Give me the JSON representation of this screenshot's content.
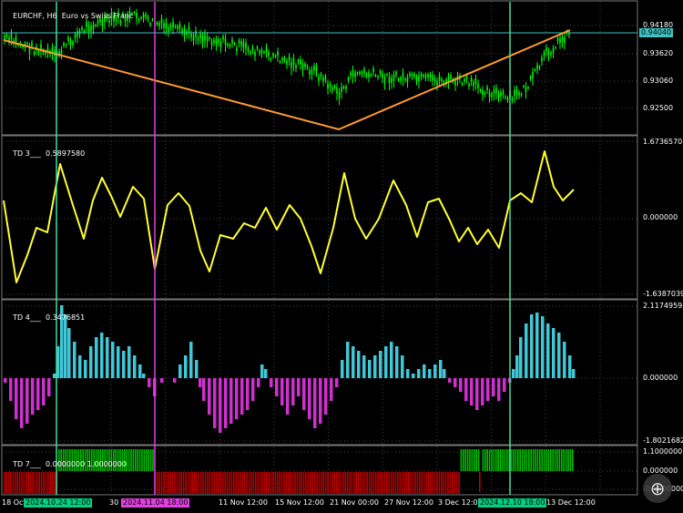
{
  "header": {
    "symbol": "EURCHF, H6",
    "description": "Euro vs Swiss Franc"
  },
  "price_axis": {
    "ticks": [
      "0.94180",
      "0.93620",
      "0.93060",
      "0.92500"
    ],
    "current_price": "0.94040"
  },
  "indicators": [
    {
      "label": "TD 3___",
      "value": "0.5897580",
      "axis": [
        "1.6736570",
        "0.000000",
        "-1.6387039"
      ]
    },
    {
      "label": "TD 4___",
      "value": "0.3476851",
      "axis": [
        "2.1174959",
        "0.000000",
        "-1.8021682"
      ]
    },
    {
      "label": "TD 7___",
      "value": "0.0000000 1.0000000",
      "axis": [
        "1.1000000",
        "0.000000",
        "-0.1000000"
      ]
    }
  ],
  "time_axis": {
    "labels": [
      "18 Oct",
      "30",
      "11 Nov 12:00",
      "15 Nov 12:00",
      "21 Nov 00:00",
      "27 Nov 12:00",
      "3 Dec 12:00",
      "13 Dec 12:00"
    ],
    "markers": [
      {
        "text": "2024.10.24 12:00",
        "bg": "#00d080"
      },
      {
        "text": "2024.11.04 18:00",
        "bg": "#e040e0"
      },
      {
        "text": "2024.12.10 18:00",
        "bg": "#00d080"
      }
    ]
  },
  "colors": {
    "candles": "#00ff00",
    "trendline": "#ff9933",
    "td3_line": "#ffff33",
    "hist_positive": "#40c8d8",
    "hist_negative": "#d030d0",
    "td7_up": "#00c000",
    "td7_down": "#c00000",
    "vline_green": "#40e0a0",
    "vline_magenta": "#e040e0",
    "price_line": "#40c0c0"
  },
  "icons": {
    "zoom": "magnifier-icon"
  }
}
